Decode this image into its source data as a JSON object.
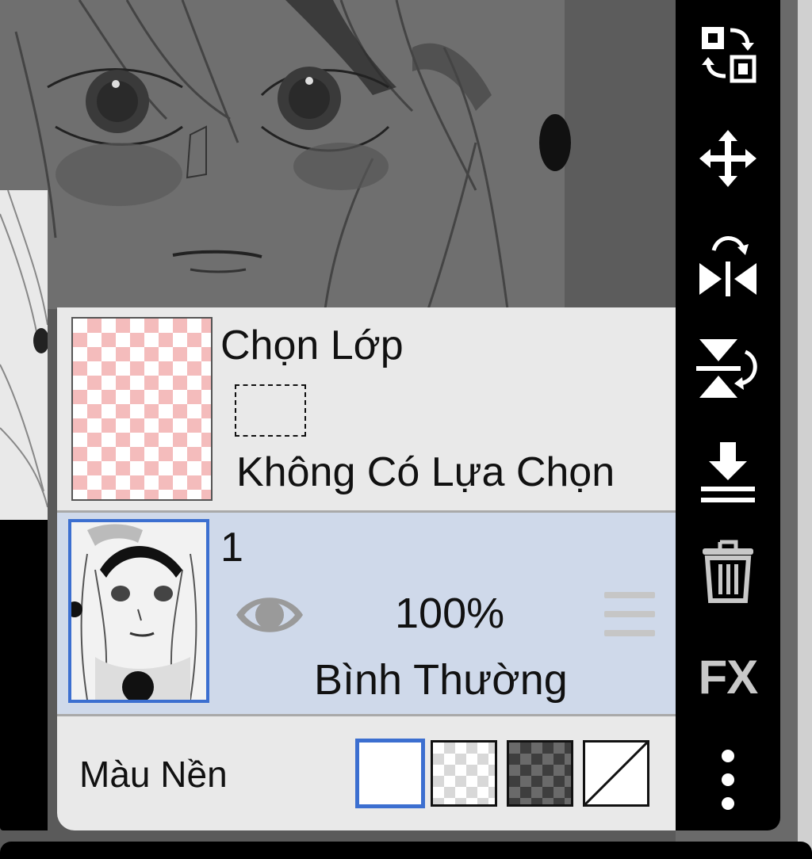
{
  "selection_layer": {
    "title": "Chọn Lớp",
    "status": "Không Có Lựa Chọn"
  },
  "layer": {
    "name": "1",
    "opacity": "100%",
    "blend_mode": "Bình Thường",
    "visible": true,
    "selected": true
  },
  "background": {
    "label": "Màu Nền",
    "swatches": [
      "white",
      "light-checker",
      "dark-checker",
      "none"
    ],
    "selected": "white"
  },
  "toolbar": {
    "items": [
      "swap-layers-icon",
      "move-icon",
      "flip-horizontal-icon",
      "flip-vertical-icon",
      "merge-down-icon",
      "trash-icon",
      "fx-button",
      "more-vertical-icon"
    ],
    "fx_label": "FX"
  },
  "colors": {
    "panel_bg": "#e9e9e9",
    "selected_layer_bg": "#cfd9ea",
    "accent_blue": "#3c6fd0",
    "selection_checker": "#f4bcbc",
    "toolbar_bg": "#000000",
    "toolbar_icon": "#ffffff",
    "disabled_icon": "#c8c8c8"
  }
}
